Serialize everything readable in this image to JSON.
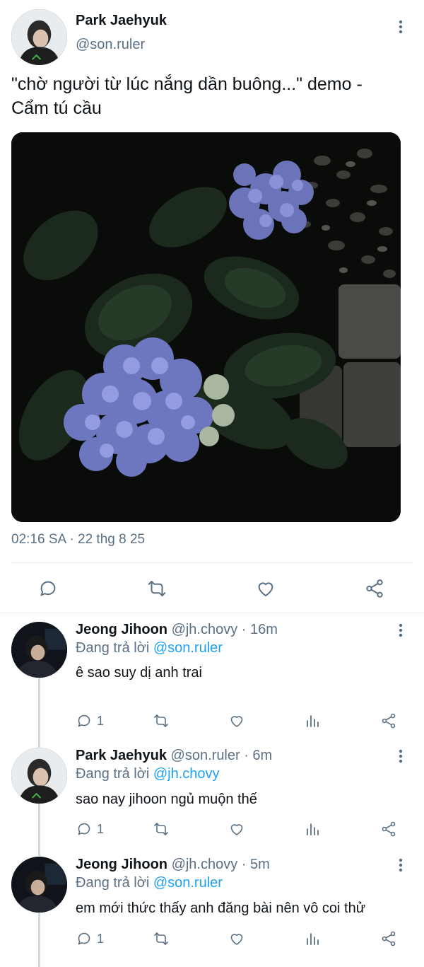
{
  "main_tweet": {
    "author_name": "Park Jaehyuk",
    "author_handle": "@son.ruler",
    "text_line1": "\"chờ người từ lúc nắng dần buông...\" demo -",
    "text_line2": "Cẩm tú cầu",
    "timestamp": "02:16 SA · 22 thg 8 25",
    "actions": [
      "reply-icon",
      "retweet-icon",
      "like-icon",
      "share-icon"
    ]
  },
  "replies": [
    {
      "name": "Jeong Jihoon",
      "handle_time": "@jh.chovy · 16m",
      "replying_prefix": "Đang trả lời ",
      "replying_to": "@son.ruler",
      "text": "ê sao suy dị anh trai",
      "reply_count": "1"
    },
    {
      "name": "Park Jaehyuk",
      "handle_time": "@son.ruler · 6m",
      "replying_prefix": "Đang trả lời ",
      "replying_to": "@jh.chovy",
      "text": "sao nay jihoon ngủ muộn thế",
      "reply_count": "1"
    },
    {
      "name": "Jeong Jihoon",
      "handle_time": "@jh.chovy · 5m",
      "replying_prefix": "Đang trả lời ",
      "replying_to": "@son.ruler",
      "text": "em mới thức thấy anh đăng bài nên vô coi thử",
      "reply_count": "1"
    }
  ],
  "colors": {
    "text": "#0f1419",
    "secondary": "#5b7083",
    "mention": "#1da1f2",
    "icon": "#5b7083"
  }
}
